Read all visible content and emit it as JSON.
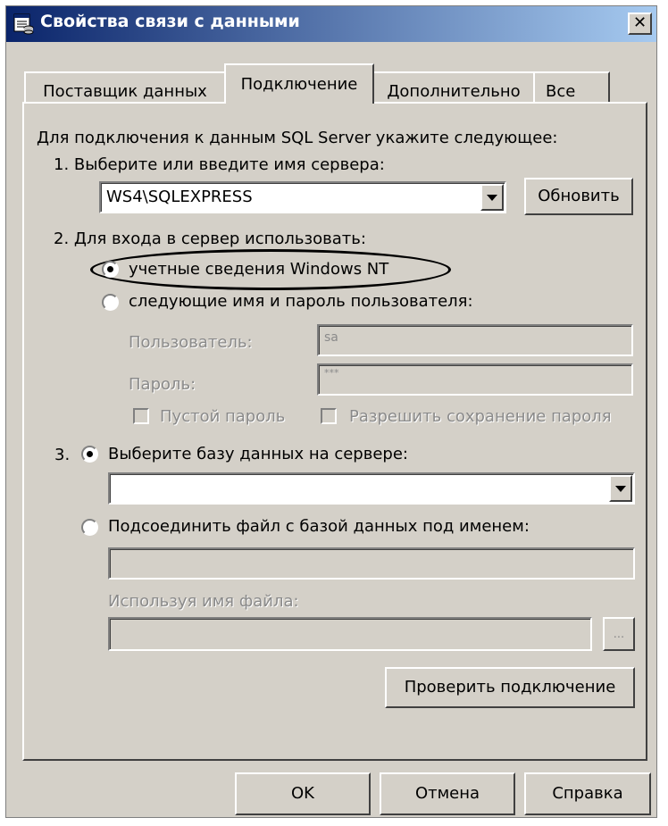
{
  "window": {
    "title": "Свойства связи с данными",
    "close_label": "✕"
  },
  "tabs": [
    {
      "label": "Поставщик данных",
      "active": false
    },
    {
      "label": "Подключение",
      "active": true
    },
    {
      "label": "Дополнительно",
      "active": false
    },
    {
      "label": "Все",
      "active": false
    }
  ],
  "connection": {
    "intro": "Для подключения к данным SQL Server укажите следующее:",
    "step1_label": "1. Выберите или введите имя сервера:",
    "server_value": "WS4\\SQLEXPRESS",
    "refresh_button": "Обновить",
    "step2_label": "2. Для входа в сервер использовать:",
    "auth_windows_label": "учетные сведения Windows NT",
    "auth_windows_selected": true,
    "auth_sql_label": "следующие имя и пароль пользователя:",
    "auth_sql_selected": false,
    "user_label": "Пользователь:",
    "user_value": "sa",
    "password_label": "Пароль:",
    "password_value": "***",
    "blank_password_label": "Пустой пароль",
    "allow_save_label": "Разрешить сохранение пароля",
    "step3_number": "3.",
    "db_select_label": "Выберите базу данных на сервере:",
    "db_select_selected": true,
    "db_value": "",
    "attach_label": "Подсоединить файл с базой данных под именем:",
    "attach_selected": false,
    "attach_value": "",
    "filename_label": "Используя имя файла:",
    "filename_value": "",
    "browse_label": "...",
    "test_button": "Проверить подключение"
  },
  "footer": {
    "ok": "OK",
    "cancel": "Отмена",
    "help": "Справка"
  },
  "colors": {
    "face": "#d4d0c8",
    "title_start": "#0a246a",
    "title_end": "#a6caf0"
  }
}
